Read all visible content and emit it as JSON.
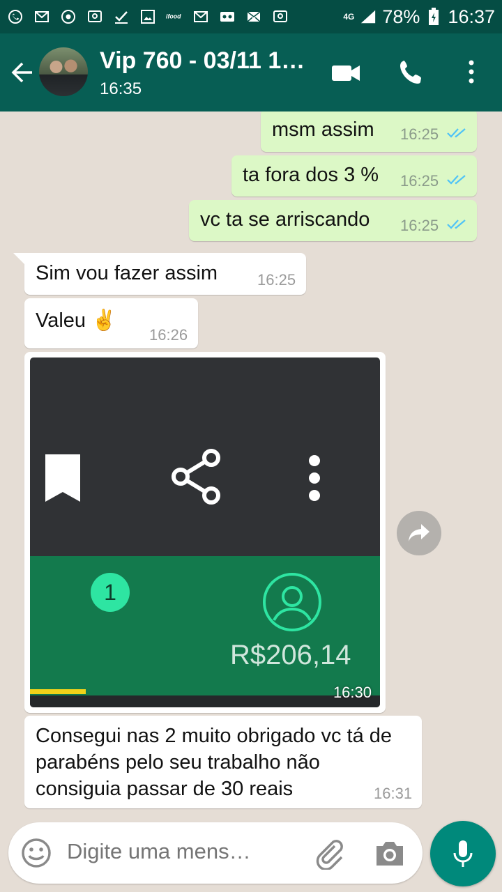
{
  "status_bar": {
    "network": "4G",
    "battery": "78%",
    "time": "16:37"
  },
  "header": {
    "title": "Vip 760 - 03/11 1…",
    "subtitle": "16:35"
  },
  "messages": [
    {
      "text": "msm assim",
      "time": "16:25",
      "direction": "outgoing"
    },
    {
      "text": "ta fora dos 3 %",
      "time": "16:25",
      "direction": "outgoing"
    },
    {
      "text": "vc ta se arriscando",
      "time": "16:25",
      "direction": "outgoing"
    },
    {
      "text": "Sim vou fazer assim",
      "time": "16:25",
      "direction": "incoming"
    },
    {
      "text": "Valeu ✌️",
      "time": "16:26",
      "direction": "incoming"
    },
    {
      "text": "Consegui nas 2 muito obrigado vc  tá de parabéns pelo seu trabalho não consiguia passar  de 30 reais",
      "time": "16:31",
      "direction": "incoming"
    }
  ],
  "image_message": {
    "time": "16:30",
    "badge": "1",
    "amount": "R$206,14"
  },
  "composer": {
    "placeholder": "Digite uma mens…"
  },
  "colors": {
    "status_bar": "#054d44",
    "app_bar": "#075e54",
    "outgoing_bubble": "#dcf8c6",
    "incoming_bubble": "#ffffff",
    "read_ticks": "#4fc3f7",
    "mic_button": "#00897b"
  },
  "icons": [
    "whatsapp-icon",
    "gmail-icon",
    "chrome-icon",
    "message-icon",
    "check-icon",
    "image-icon",
    "ifood-icon",
    "voicemail-icon",
    "mail-icon",
    "signal-icon",
    "battery-icon",
    "back-arrow-icon",
    "video-call-icon",
    "phone-icon",
    "more-vert-icon",
    "read-ticks-icon",
    "bookmark-icon",
    "share-icon",
    "forward-icon",
    "emoji-icon",
    "attach-icon",
    "camera-icon",
    "mic-icon"
  ]
}
